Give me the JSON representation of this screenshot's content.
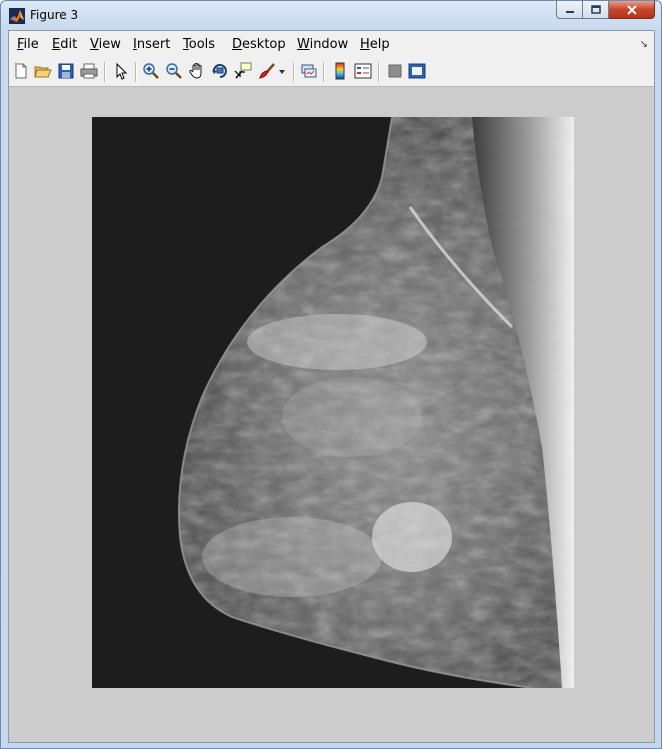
{
  "window": {
    "title": "Figure 3",
    "title_icon": "matlab-logo-icon"
  },
  "menu": [
    {
      "label": "File",
      "key": "F"
    },
    {
      "label": "Edit",
      "key": "E"
    },
    {
      "label": "View",
      "key": "V"
    },
    {
      "label": "Insert",
      "key": "I"
    },
    {
      "label": "Tools",
      "key": "T"
    },
    {
      "label": "Desktop",
      "key": "D"
    },
    {
      "label": "Window",
      "key": "W"
    },
    {
      "label": "Help",
      "key": "H"
    }
  ],
  "toolbar": [
    "new-figure-icon",
    "open-file-icon",
    "save-icon",
    "print-icon",
    "edit-plot-arrow-icon",
    "zoom-in-icon",
    "zoom-out-icon",
    "pan-hand-icon",
    "rotate-3d-icon",
    "data-cursor-icon",
    "brush-icon",
    "brush-dropdown-icon",
    "link-plot-icon",
    "colorbar-icon",
    "legend-icon",
    "hide-plot-tools-icon",
    "show-plot-tools-icon"
  ],
  "figure": {
    "content": "grayscale mammogram image",
    "background_color": "#cccccc"
  },
  "colors": {
    "titlebar": "#dbe8f6",
    "menubar": "#f0f0f0",
    "close_button": "#c7452c"
  }
}
